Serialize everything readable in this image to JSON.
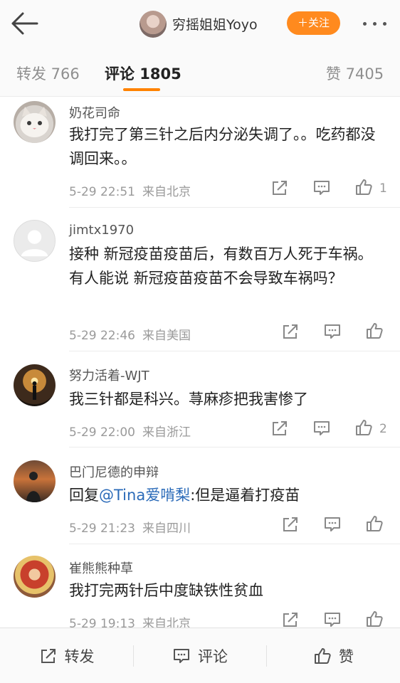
{
  "header": {
    "back_icon": "arrow-left-icon",
    "user_name": "穷摇姐姐Yoyo",
    "follow_label": "＋关注",
    "follow_color": "#ff8a1e",
    "more_icon": "more-dots-icon"
  },
  "tabs": {
    "reposts": "转发 766",
    "comments": "评论 1805",
    "likes": "赞 7405",
    "active": "comments",
    "accent": "#ff8200"
  },
  "comments": [
    {
      "name": "奶花司命",
      "text": "我打完了第三针之后内分泌失调了。。吃药都没调回来。。",
      "date": "5-29 22:51",
      "location": "来自北京",
      "likes": "1"
    },
    {
      "name": "jimtx1970",
      "text": "接种 新冠疫苗疫苗后，有数百万人死于车祸。 有人能说 新冠疫苗疫苗不会导致车祸吗？",
      "date": "5-29 22:46",
      "location": "来自美国",
      "likes": ""
    },
    {
      "name": "努力活着-WJT",
      "text": "我三针都是科兴。荨麻疹把我害惨了",
      "date": "5-29 22:00",
      "location": "来自浙江",
      "likes": "2"
    },
    {
      "name": "巴门尼德的申辩",
      "reply_prefix": "回复",
      "mention": "@Tina爱啃梨",
      "reply_text": ":但是逼着打疫苗",
      "date": "5-29 21:23",
      "location": "来自四川",
      "likes": ""
    },
    {
      "name": "崔熊熊种草",
      "text": "我打完两针后中度缺铁性贫血",
      "date": "5-29 19:13",
      "location": "来自北京",
      "likes": ""
    }
  ],
  "bottom_bar": {
    "repost": "转发",
    "comment": "评论",
    "like": "赞"
  }
}
